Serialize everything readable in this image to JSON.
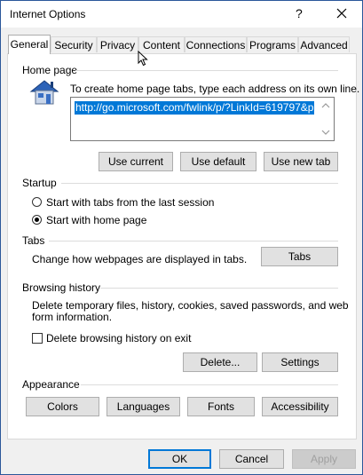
{
  "window": {
    "title": "Internet Options",
    "help_glyph": "?"
  },
  "tabs": [
    "General",
    "Security",
    "Privacy",
    "Content",
    "Connections",
    "Programs",
    "Advanced"
  ],
  "home_page": {
    "group_label": "Home page",
    "instruction": "To create home page tabs, type each address on its own line.",
    "url_value": "http://go.microsoft.com/fwlink/p/?LinkId=619797&p",
    "buttons": {
      "use_current": "Use current",
      "use_default": "Use default",
      "use_new_tab": "Use new tab"
    }
  },
  "startup": {
    "group_label": "Startup",
    "option_tabs_last_session": "Start with tabs from the last session",
    "option_home_page": "Start with home page",
    "selected": "home_page"
  },
  "tabs_section": {
    "group_label": "Tabs",
    "description": "Change how webpages are displayed in tabs.",
    "button": "Tabs"
  },
  "browsing_history": {
    "group_label": "Browsing history",
    "description_line1": "Delete temporary files, history, cookies, saved passwords, and web",
    "description_line2": "form information.",
    "checkbox_label": "Delete browsing history on exit",
    "checkbox_checked": false,
    "delete_button": "Delete...",
    "settings_button": "Settings"
  },
  "appearance": {
    "group_label": "Appearance",
    "colors_button": "Colors",
    "languages_button": "Languages",
    "fonts_button": "Fonts",
    "accessibility_button": "Accessibility"
  },
  "footer": {
    "ok": "OK",
    "cancel": "Cancel",
    "apply": "Apply"
  },
  "colors": {
    "accent": "#0078d7",
    "window_border": "#2b579a"
  }
}
